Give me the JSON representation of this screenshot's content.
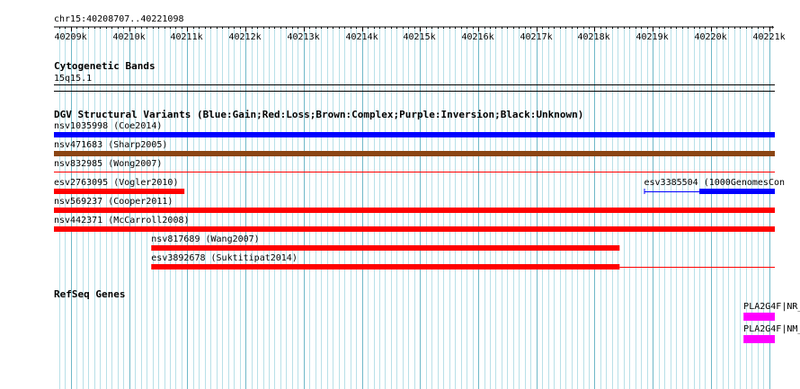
{
  "region": {
    "label": "chr15:40208707..40221098",
    "start": 40208707,
    "end": 40221098
  },
  "ruler": {
    "ticks": [
      {
        "pos": 40209000,
        "label": "40209k"
      },
      {
        "pos": 40210000,
        "label": "40210k"
      },
      {
        "pos": 40211000,
        "label": "40211k"
      },
      {
        "pos": 40212000,
        "label": "40212k"
      },
      {
        "pos": 40213000,
        "label": "40213k"
      },
      {
        "pos": 40214000,
        "label": "40214k"
      },
      {
        "pos": 40215000,
        "label": "40215k"
      },
      {
        "pos": 40216000,
        "label": "40216k"
      },
      {
        "pos": 40217000,
        "label": "40217k"
      },
      {
        "pos": 40218000,
        "label": "40218k"
      },
      {
        "pos": 40219000,
        "label": "40219k"
      },
      {
        "pos": 40220000,
        "label": "40220k"
      },
      {
        "pos": 40221000,
        "label": "40221k"
      }
    ]
  },
  "cytogenetic": {
    "title": "Cytogenetic Bands",
    "band": "15q15.1"
  },
  "dgv": {
    "title": "DGV Structural Variants (Blue:Gain;Red:Loss;Brown:Complex;Purple:Inversion;Black:Unknown)",
    "colors": {
      "gain": "#0000ff",
      "loss": "#ff0000",
      "complex": "#8b4513"
    },
    "variants": [
      {
        "label": "nsv1035998 (Coe2014)",
        "type": "gain",
        "start": 40208707,
        "end": 40221098
      },
      {
        "label": "nsv471683 (Sharp2005)",
        "type": "complex",
        "start": 40208707,
        "end": 40221098
      },
      {
        "label": "nsv832985 (Wong2007)",
        "type": "loss",
        "style": "line",
        "start": 40208707,
        "end": 40221098
      },
      {
        "label": "esv2763095 (Vogler2010)",
        "type": "loss",
        "start": 40208707,
        "end": 40210950
      },
      {
        "label": "esv3385504 (1000GenomesCon",
        "type": "gain",
        "start": 40219800,
        "end": 40221098,
        "line_start": 40218850
      },
      {
        "label": "nsv569237 (Cooper2011)",
        "type": "loss",
        "start": 40208707,
        "end": 40221098
      },
      {
        "label": "nsv442371 (McCarroll2008)",
        "type": "loss",
        "start": 40208707,
        "end": 40221098
      },
      {
        "label": "nsv817689 (Wang2007)",
        "type": "loss",
        "start": 40210380,
        "end": 40218430
      },
      {
        "label": "esv3892678 (Suktitipat2014)",
        "type": "loss",
        "start": 40210380,
        "end": 40218430,
        "line_end": 40221098
      }
    ]
  },
  "refseq": {
    "title": "RefSeq Genes",
    "color": "#ff00ff",
    "genes": [
      {
        "label": "PLA2G4F|NR_",
        "start": 40220560,
        "end": 40221098
      },
      {
        "label": "PLA2G4F|NM_",
        "start": 40220560,
        "end": 40221098
      }
    ]
  }
}
